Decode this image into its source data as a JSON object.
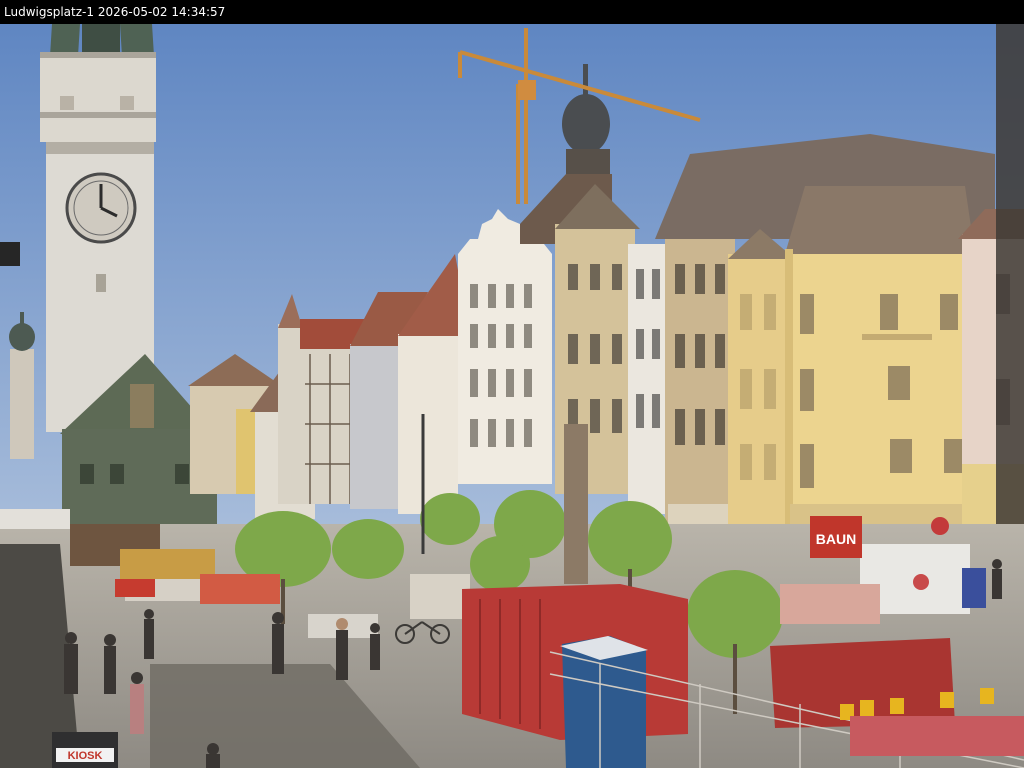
{
  "overlay": {
    "camera_label": "Ludwigsplatz-1",
    "timestamp": "2026-05-02 14:34:57"
  },
  "signage": {
    "kiosk": "KIOSK",
    "store": "BAUN"
  },
  "colors": {
    "sky_top": "#5f86c2",
    "sky_bottom": "#c9d6e6",
    "tower": "#d9d6cf",
    "gable_white": "#ece7dc",
    "facade_yellow": "#e8cf8a",
    "facade_ochre": "#cfb78b",
    "roof": "#8b6f5a",
    "red_container": "#b83a36",
    "toilet_blue": "#2e5a8e",
    "trees": "#7ea84a",
    "pavement": "#9a968e"
  }
}
